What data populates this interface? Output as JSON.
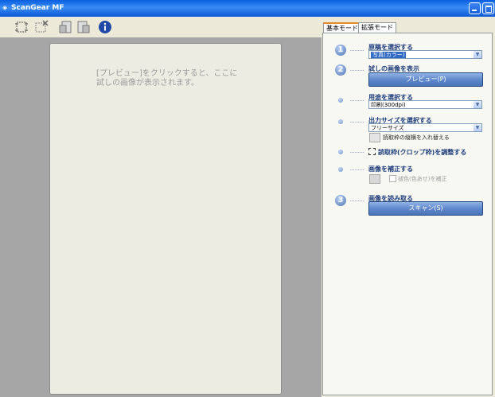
{
  "window": {
    "title": "ScanGear MF"
  },
  "toolbar": {
    "icons": [
      "auto-crop-icon",
      "clear-crop-icon",
      "rotate-left-icon",
      "rotate-right-icon",
      "info-icon"
    ]
  },
  "preview": {
    "hint": "[プレビュー]をクリックすると、ここに\n試しの画像が表示されます。"
  },
  "tabs": [
    {
      "label": "基本モード"
    },
    {
      "label": "拡張モード"
    }
  ],
  "steps": {
    "s1": {
      "number": "1",
      "label": "原稿を選択する",
      "select_value": "写真(カラー)"
    },
    "s2": {
      "number": "2",
      "label": "試しの画像を表示",
      "button": "プレビュー(P)"
    },
    "purpose": {
      "label": "用途を選択する",
      "select_value": "印刷(300dpi)"
    },
    "output": {
      "label": "出力サイズを選択する",
      "select_value": "フリーサイズ",
      "swap_label": "読取枠の縦横を入れ替える"
    },
    "crop": {
      "label": "読取枠(クロップ枠)を調整する"
    },
    "correct": {
      "label": "画像を補正する",
      "checkbox_label": "褪色(色あせ)を補正"
    },
    "s3": {
      "number": "3",
      "label": "画像を読み取る",
      "button": "スキャン(S)"
    }
  }
}
